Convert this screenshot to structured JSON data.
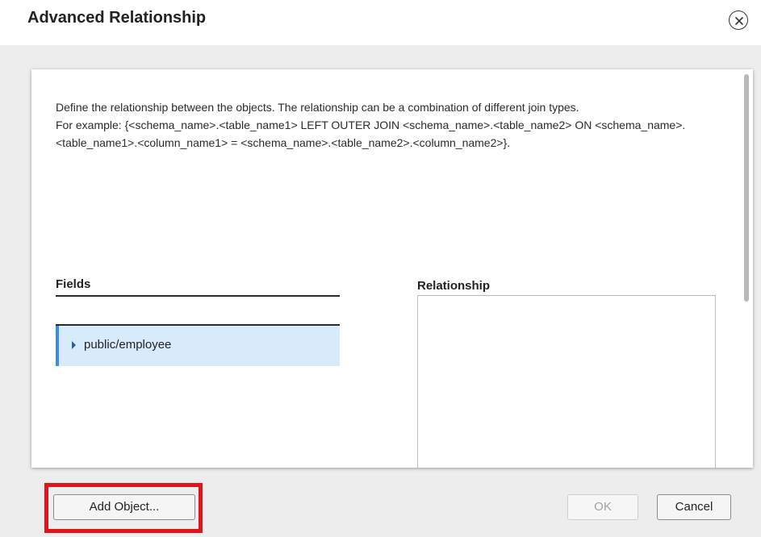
{
  "dialog": {
    "title": "Advanced Relationship",
    "close_icon": "close-circle-icon"
  },
  "description": {
    "line1": "Define the relationship between the objects. The relationship can be a combination of different join types.",
    "line2": "For example: {<schema_name>.<table_name1> LEFT OUTER JOIN <schema_name>.<table_name2> ON <schema_name>.<table_name1>.<column_name1> = <schema_name>.<table_name2>.<column_name2>}."
  },
  "fields": {
    "title": "Fields",
    "items": [
      {
        "label": "public/employee",
        "icon": "caret-right-icon",
        "selected": true
      }
    ]
  },
  "relationship": {
    "title": "Relationship",
    "value": ""
  },
  "buttons": {
    "add_object": "Add Object...",
    "ok": "OK",
    "cancel": "Cancel"
  },
  "colors": {
    "selection_bg": "#d7ebfa",
    "selection_accent": "#3a8ee6",
    "highlight": "#e0151c"
  }
}
